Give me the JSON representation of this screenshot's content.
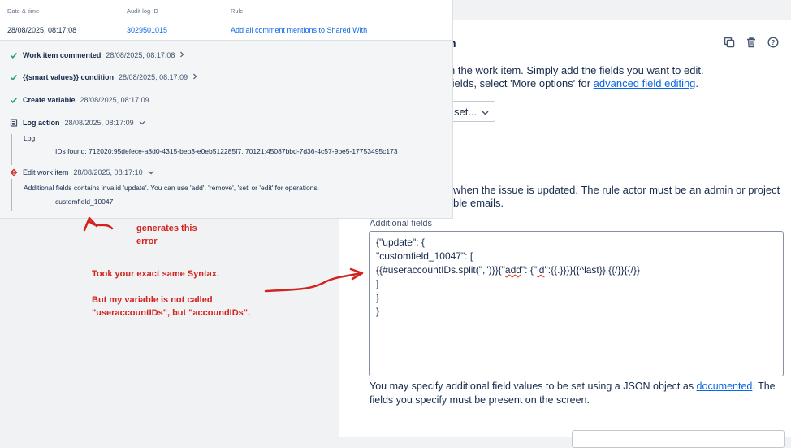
{
  "right_panel": {
    "title_fragment": "n",
    "desc_line1": "n the work item. Simply add the fields you want to edit.",
    "desc_line2_prefix": "fields, select 'More options' for ",
    "desc_link": "advanced field editing",
    "desc_line2_suffix": ".",
    "select_value": "set...",
    "desc2_line1": "when the issue is updated. The rule actor must be an admin or project",
    "desc2_line2": "ble emails.",
    "additional_fields_label": "Additional fields",
    "json_lines": {
      "l1": "{\"update\": {",
      "l2": "\"customfield_10047\": [",
      "l3_a": "{{#",
      "l3_b": "useraccountIDs",
      "l3_c": ".split(\",\")}}{\"",
      "l3_d": "add",
      "l3_e": "\": {\"",
      "l3_f": "id",
      "l3_g": "\":{{.}}}}{{^last}},{{/}}{{/}}",
      "l4": "]",
      "l5": "}",
      "l6": "}"
    },
    "help_prefix": "You may specify additional field values to be set using a JSON object as ",
    "help_link": "documented",
    "help_suffix": ". The fields you specify must be present on the screen."
  },
  "audit_log": {
    "headers": {
      "date": "Date & time",
      "id": "Audit log ID",
      "rule": "Rule"
    },
    "row": {
      "date": "28/08/2025, 08:17:08",
      "id": "3029501015",
      "rule": "Add all comment mentions to Shared With"
    },
    "steps": [
      {
        "title": "Work item commented",
        "time": "28/08/2025, 08:17:08"
      },
      {
        "title": "{{smart values}} condition",
        "time": "28/08/2025, 08:17:09"
      },
      {
        "title": "Create variable",
        "time": "28/08/2025, 08:17:09"
      },
      {
        "title": "Log action",
        "time": "28/08/2025, 08:17:09"
      },
      {
        "title": "Edit work item",
        "time": "28/08/2025, 08:17:10"
      }
    ],
    "log_label": "Log",
    "log_message": "IDs found: 712020:95defece-a8d0-4315-beb3-e0eb512285f7, 70121:45087bbd-7d36-4c57-9be5-17753495c173",
    "error_message": "Additional fields contains invalid 'update'. You can use 'add', 'remove', 'set' or 'edit' for operations.",
    "error_field": "customfield_10047"
  },
  "annotations": {
    "generates_line1": "generates this",
    "generates_line2": "error",
    "syntax": "Took your exact same Syntax.",
    "variable_line1": "But my variable is not called",
    "variable_line2": "\"useraccountIDs\", but \"accoundIDs\"."
  },
  "colors": {
    "annotation": "#d3231f",
    "link": "#0c66e4",
    "error": "#c9372c"
  }
}
